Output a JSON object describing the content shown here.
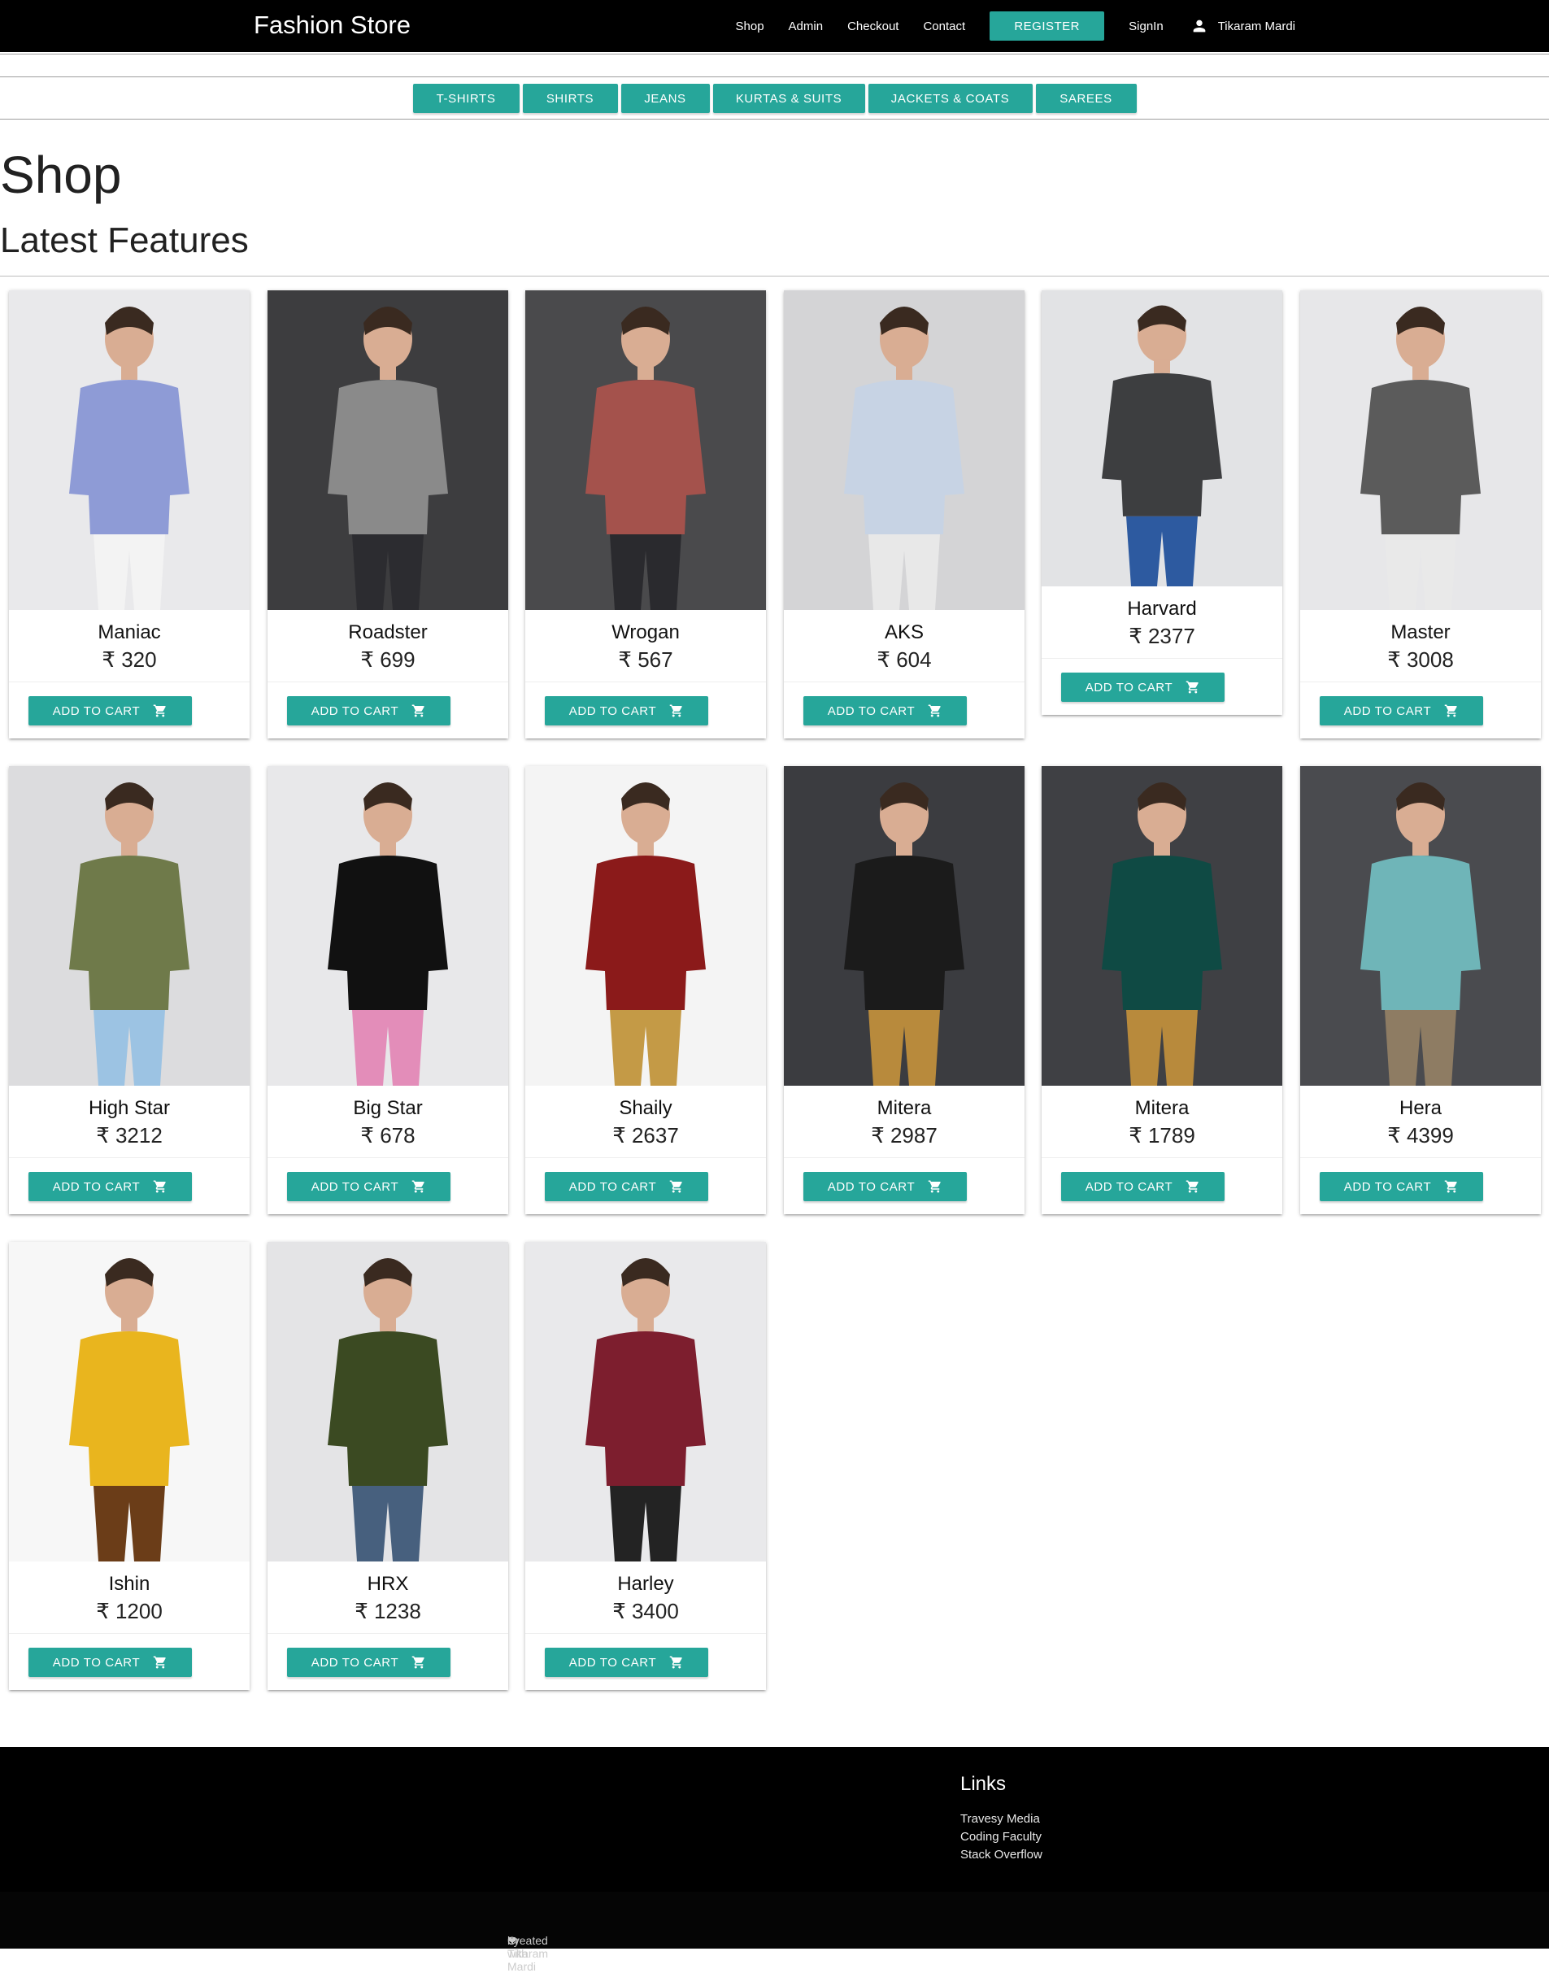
{
  "header": {
    "brand": "Fashion Store",
    "links": [
      "Shop",
      "Admin",
      "Checkout",
      "Contact"
    ],
    "register": "REGISTER",
    "signin": "SignIn",
    "user": "Tikaram Mardi"
  },
  "categories": [
    "T-SHIRTS",
    "SHIRTS",
    "JEANS",
    "KURTAS & SUITS",
    "JACKETS & COATS",
    "SAREES"
  ],
  "page_title": "Shop",
  "section_title": "Latest Features",
  "add_to_cart_label": "ADD TO CART",
  "products": [
    {
      "name": "Maniac",
      "price": "₹ 320"
    },
    {
      "name": "Roadster",
      "price": "₹ 699"
    },
    {
      "name": "Wrogan",
      "price": "₹ 567"
    },
    {
      "name": "AKS",
      "price": "₹ 604"
    },
    {
      "name": "Harvard",
      "price": "₹ 2377"
    },
    {
      "name": "Master",
      "price": "₹ 3008"
    },
    {
      "name": "High Star",
      "price": "₹ 3212"
    },
    {
      "name": "Big Star",
      "price": "₹ 678"
    },
    {
      "name": "Shaily",
      "price": "₹ 2637"
    },
    {
      "name": "Mitera",
      "price": "₹ 2987"
    },
    {
      "name": "Mitera",
      "price": "₹ 1789"
    },
    {
      "name": "Hera",
      "price": "₹ 4399"
    },
    {
      "name": "Ishin",
      "price": "₹ 1200"
    },
    {
      "name": "HRX",
      "price": "₹ 1238"
    },
    {
      "name": "Harley",
      "price": "₹ 3400"
    }
  ],
  "footer": {
    "links_title": "Links",
    "links": [
      "Travesy Media",
      "Coding Faculty",
      "Stack Overflow"
    ],
    "credit_prefix": "Created with",
    "credit_heart": "❤",
    "credit_suffix": "by Tikaram Mardi"
  },
  "colors": {
    "accent": "#26a69a",
    "nav_bg": "#000000"
  }
}
